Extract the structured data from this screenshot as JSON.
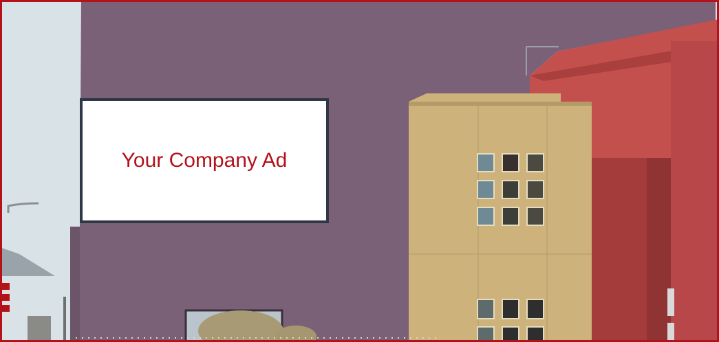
{
  "billboard": {
    "ad_text": "Your Company Ad"
  },
  "colors": {
    "frame": "#b3121b",
    "sky": "#d9e2e6",
    "purple_wall": "#7b6178",
    "tan_tower": "#cdb27c",
    "red_wall": "#c4504d",
    "ad_text": "#b3121b"
  }
}
